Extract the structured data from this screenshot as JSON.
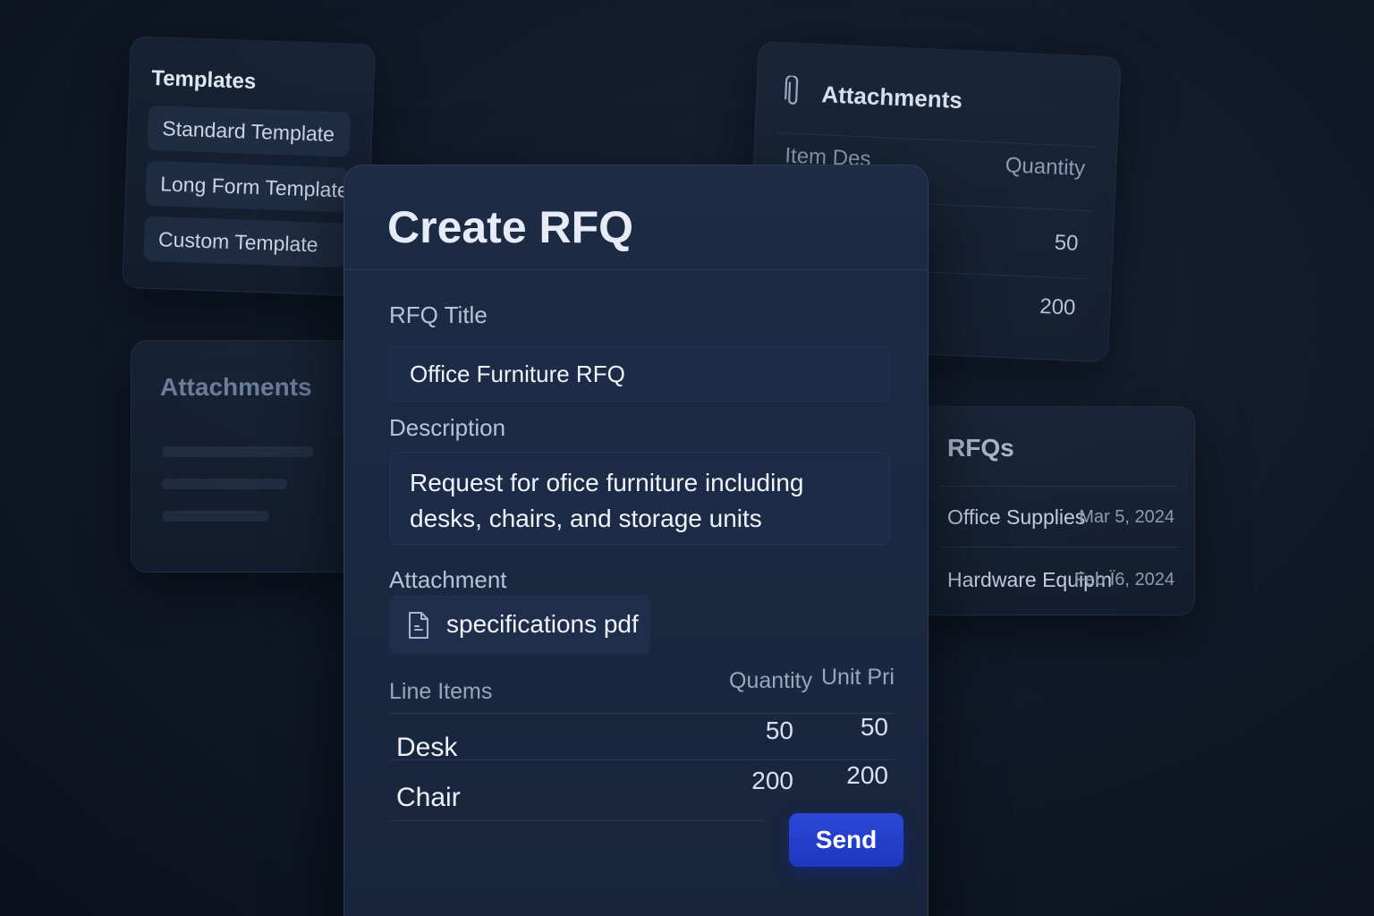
{
  "templates": {
    "title": "Templates",
    "items": [
      {
        "label": "Standard Template"
      },
      {
        "label": "Long Form Template"
      },
      {
        "label": "Custom Template"
      }
    ]
  },
  "attachments_left": {
    "title": "Attachments"
  },
  "attachments_right": {
    "title": "Attachments",
    "icon": "paperclip-icon",
    "columns": {
      "item": "Item Des",
      "quantity": "Quantity"
    },
    "rows": [
      {
        "quantity": "50"
      },
      {
        "quantity": "200"
      }
    ]
  },
  "rfqs": {
    "title": "RFQs",
    "items": [
      {
        "name": "Office Supplies",
        "date": "Mar 5, 2024"
      },
      {
        "name": "Hardware Equipm",
        "date": "Feb Ϊ6, 2024"
      }
    ]
  },
  "create_rfq": {
    "title": "Create RFQ",
    "rfq_title_label": "RFQ Title",
    "rfq_title_value": "Office Furniture RFQ",
    "description_label": "Description",
    "description_value": "Request for ofice furniture including desks, chairs, and storage units",
    "attachment_label": "Attachment",
    "attachment_file": "specifications pdf",
    "attachment_icon": "file-icon",
    "line_items": {
      "label": "Line Items",
      "col_quantity": "Quantity",
      "col_unit_price": "Unit Pri",
      "rows": [
        {
          "name": "Desk",
          "quantity": "50",
          "unit_price": "50"
        },
        {
          "name": "Chair",
          "quantity": "200",
          "unit_price": "200"
        }
      ]
    },
    "send_label": "Send"
  },
  "colors": {
    "background": "#111a29",
    "card": "#1d2b45",
    "accent": "#2a47d6"
  }
}
